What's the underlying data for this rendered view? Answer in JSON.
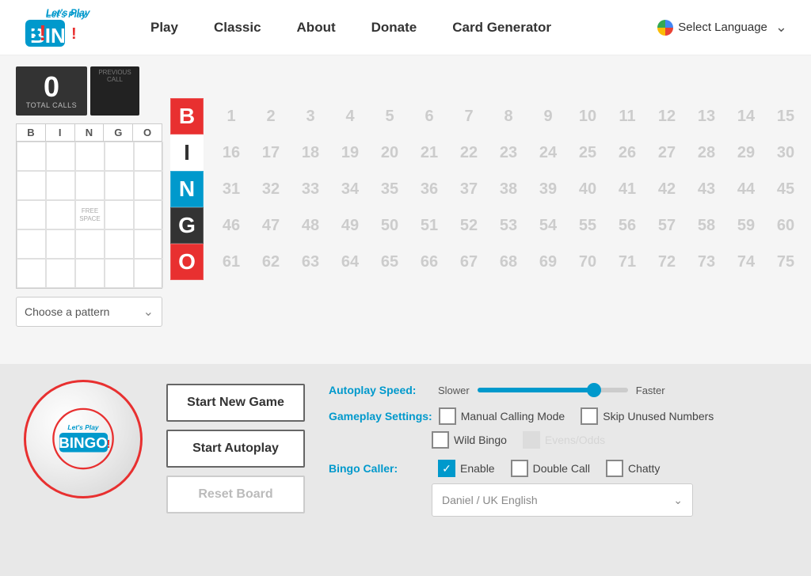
{
  "header": {
    "logo_top": "Let's Play",
    "logo_main": "BINGO!",
    "nav_items": [
      {
        "label": "Play",
        "id": "play"
      },
      {
        "label": "Classic",
        "id": "classic"
      },
      {
        "label": "About",
        "id": "about"
      },
      {
        "label": "Donate",
        "id": "donate"
      },
      {
        "label": "Card Generator",
        "id": "card-generator"
      }
    ],
    "language_label": "Select Language"
  },
  "game": {
    "total_calls": "0",
    "total_calls_label": "TOTAL CALLS",
    "previous_call_label": "PREVIOUS CALL",
    "bingo_letters": [
      "B",
      "I",
      "N",
      "G",
      "O"
    ],
    "pattern_label": "Choose a pattern",
    "free_space_line1": "FREE",
    "free_space_line2": "SPACE",
    "numbers": [
      1,
      2,
      3,
      4,
      5,
      6,
      7,
      8,
      9,
      10,
      11,
      12,
      13,
      14,
      15,
      16,
      17,
      18,
      19,
      20,
      21,
      22,
      23,
      24,
      25,
      26,
      27,
      28,
      29,
      30,
      31,
      32,
      33,
      34,
      35,
      36,
      37,
      38,
      39,
      40,
      41,
      42,
      43,
      44,
      45,
      46,
      47,
      48,
      49,
      50,
      51,
      52,
      53,
      54,
      55,
      56,
      57,
      58,
      59,
      60,
      61,
      62,
      63,
      64,
      65,
      66,
      67,
      68,
      69,
      70,
      71,
      72,
      73,
      74,
      75
    ]
  },
  "bottom": {
    "ball_logo_top": "Let's Play",
    "ball_logo_main": "BINGO!",
    "buttons": {
      "start_new_game": "Start New Game",
      "start_autoplay": "Start Autoplay",
      "reset_board": "Reset Board"
    },
    "autoplay_speed_label": "Autoplay Speed:",
    "slower_label": "Slower",
    "faster_label": "Faster",
    "gameplay_settings_label": "Gameplay Settings:",
    "manual_calling_label": "Manual Calling Mode",
    "skip_unused_label": "Skip Unused Numbers",
    "wild_bingo_label": "Wild Bingo",
    "evens_odds_label": "Evens/Odds",
    "bingo_caller_label": "Bingo Caller:",
    "enable_label": "Enable",
    "double_call_label": "Double Call",
    "chatty_label": "Chatty",
    "caller_value": "Daniel / UK English",
    "caller_placeholder": "Daniel / UK English"
  }
}
